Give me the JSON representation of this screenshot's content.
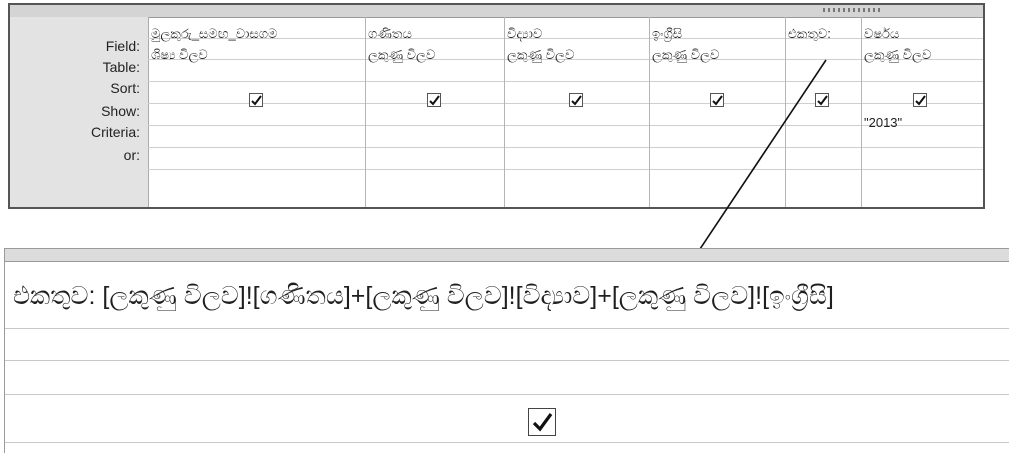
{
  "row_labels": [
    "Field:",
    "Table:",
    "Sort:",
    "Show:",
    "Criteria:",
    "or:"
  ],
  "columns": [
    {
      "field": "මුලකුරු_සමඟ_වාසගම",
      "table": "ශිෂ්‍ය විලව",
      "sort": "",
      "show": true,
      "criteria": "",
      "or": ""
    },
    {
      "field": "ගණිතය",
      "table": "ලකුණු විලව",
      "sort": "",
      "show": true,
      "criteria": "",
      "or": ""
    },
    {
      "field": "විද්‍යාව",
      "table": "ලකුණු විලව",
      "sort": "",
      "show": true,
      "criteria": "",
      "or": ""
    },
    {
      "field": "ඉංග්‍රීසි",
      "table": "ලකුණු විලව",
      "sort": "",
      "show": true,
      "criteria": "",
      "or": ""
    },
    {
      "field": "එකතුව:",
      "table": "",
      "sort": "",
      "show": true,
      "criteria": "",
      "or": ""
    },
    {
      "field": "වර්ෂය",
      "table": "ලකුණු විලව",
      "sort": "",
      "show": true,
      "criteria": "\"2013\"",
      "or": ""
    }
  ],
  "zoomed": {
    "field_expression": "එකතුව: [ලකුණු විලව]![ගණිතය]+[ලකුණු විලව]![විද්‍යාව]+[ලකුණු විලව]![ඉංග්‍රීසි]",
    "show": true
  },
  "icons": {
    "check": "checkmark-icon",
    "arrow": "arrow-icon"
  }
}
